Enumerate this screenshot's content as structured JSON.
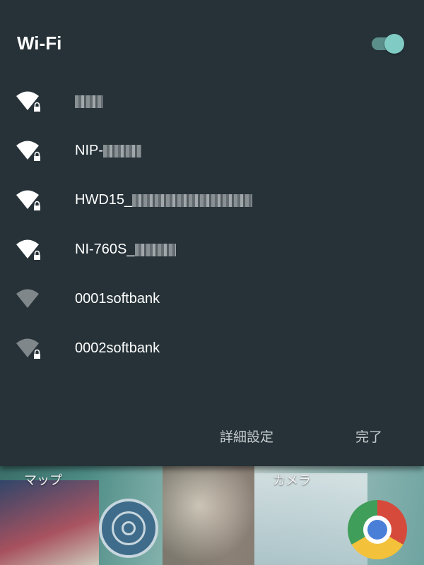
{
  "dialog": {
    "title": "Wi-Fi",
    "toggle_on": true
  },
  "networks": [
    {
      "name": "",
      "secured": true
    },
    {
      "name": "NIP-",
      "secured": true
    },
    {
      "name": "HWD15_",
      "secured": true
    },
    {
      "name": "NI-760S_",
      "secured": true
    },
    {
      "name": "0001softbank",
      "secured": false
    },
    {
      "name": "0002softbank",
      "secured": true
    }
  ],
  "actions": {
    "advanced_label": "詳細設定",
    "done_label": "完了"
  },
  "home_screen": {
    "maps_label": "マップ",
    "camera_label": "カメラ"
  },
  "colors": {
    "dialog_bg": "#263238",
    "accent": "#80cbc4"
  }
}
